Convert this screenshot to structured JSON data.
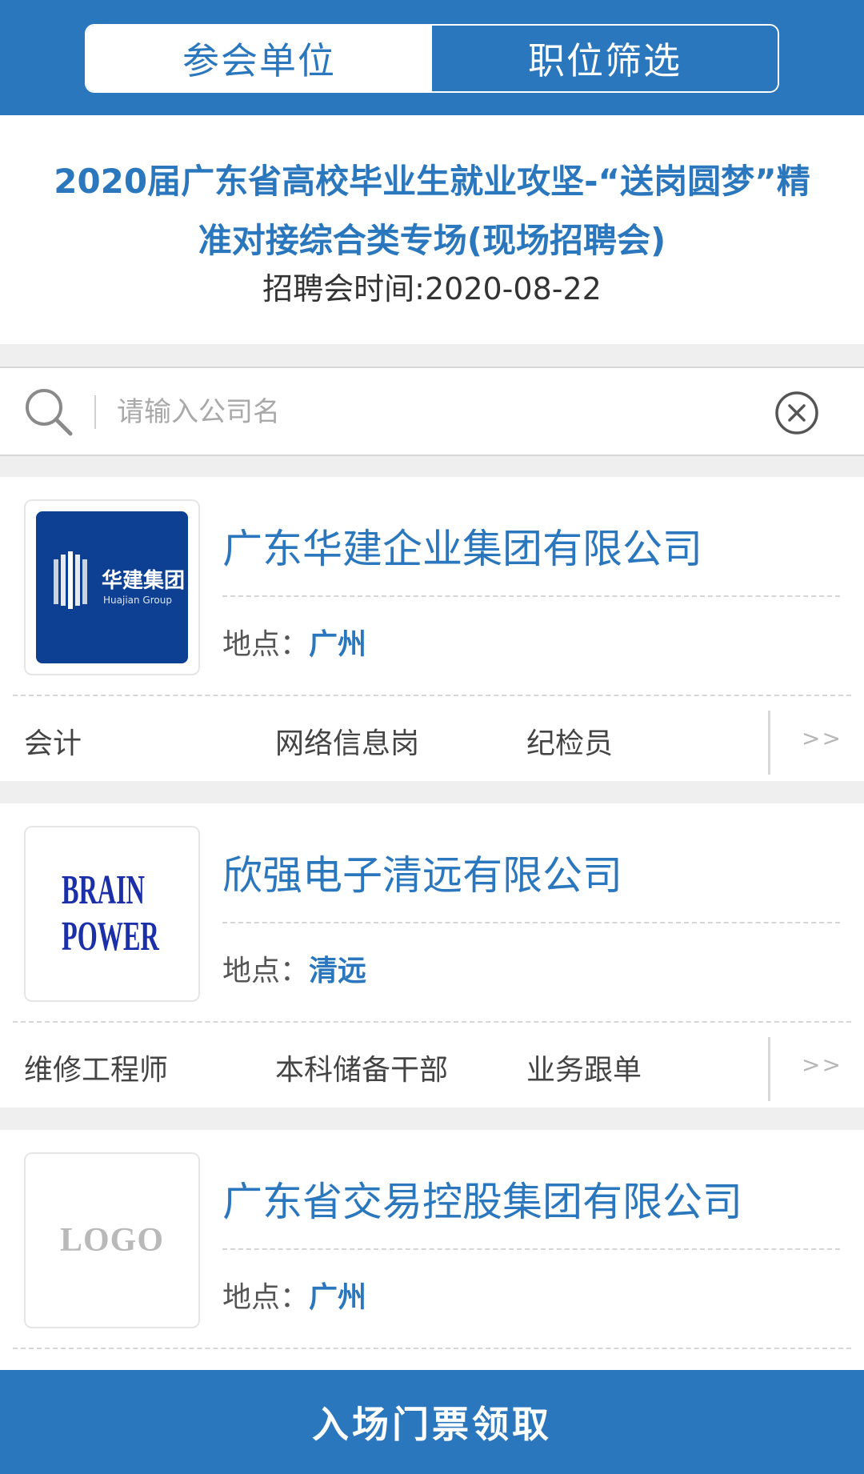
{
  "tabs": [
    {
      "label": "参会单位",
      "active": true
    },
    {
      "label": "职位筛选",
      "active": false
    }
  ],
  "event": {
    "title": "2020届广东省高校毕业生就业攻坚-“送岗圆梦”精准对接综合类专场(现场招聘会)",
    "time": "招聘会时间:2020-08-22"
  },
  "search": {
    "placeholder": "请输入公司名",
    "value": "",
    "icon": "search-icon",
    "clear_icon": "clear-circle-icon"
  },
  "companies": [
    {
      "name": "广东华建企业集团有限公司",
      "location_label": "地点：",
      "city": "广州",
      "logo": {
        "type": "huajian",
        "cn": "华建集团",
        "en": "Huajian Group"
      },
      "jobs": [
        "会计",
        "网络信息岗",
        "纪检员"
      ],
      "more": ">>"
    },
    {
      "name": "欣强电子清远有限公司",
      "location_label": "地点：",
      "city": "清远",
      "logo": {
        "type": "brainpower",
        "line1": "BRAIN",
        "line2": "POWER"
      },
      "jobs": [
        "维修工程师",
        "本科储备干部",
        "业务跟单"
      ],
      "more": ">>"
    },
    {
      "name": "广东省交易控股集团有限公司",
      "location_label": "地点：",
      "city": "广州",
      "logo": {
        "type": "placeholder",
        "text": "LOGO"
      },
      "jobs": [],
      "more": ""
    }
  ],
  "bottom_button": {
    "label": "入场门票领取"
  },
  "colors": {
    "primary": "#2a77bd",
    "background": "#efefef",
    "logo_navy": "#0d3f93"
  }
}
